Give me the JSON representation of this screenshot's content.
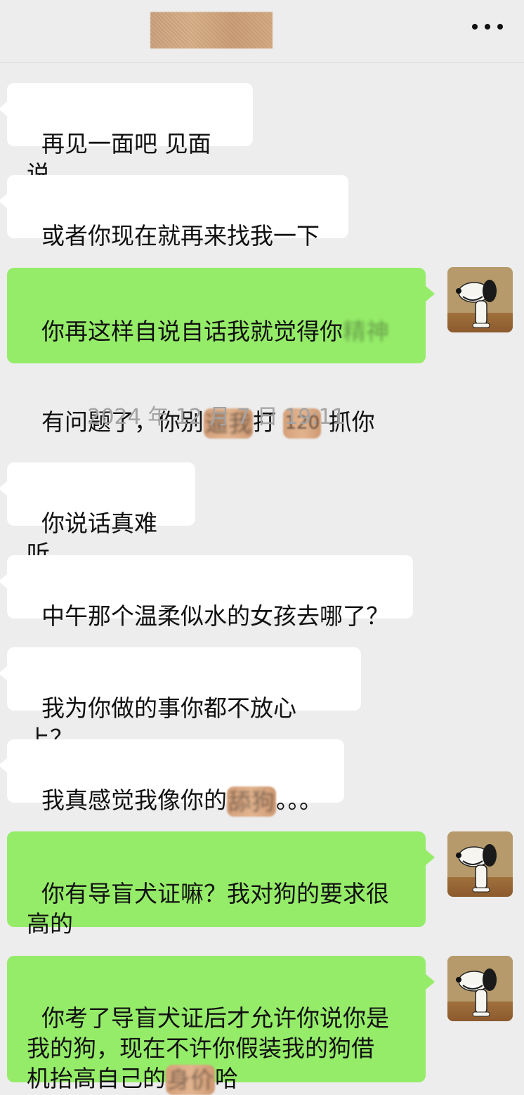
{
  "header": {
    "title_redacted": true,
    "more_icon": "more-dots-icon"
  },
  "avatar": {
    "icon": "snoopy-avatar"
  },
  "messages": [
    {
      "side": "in",
      "text": "再见一面吧 见面说"
    },
    {
      "side": "in",
      "text": "或者你现在就再来找我一下"
    },
    {
      "side": "out",
      "line1": "你再这样自说自话我就觉得你",
      "line1_tail": "精神",
      "line2a": "有问题了，你别",
      "line2_redact": "逼我",
      "line2b": "打",
      "line2_redact2": "120",
      "line2c": "抓你"
    },
    {
      "side": "in",
      "text": "你说话真难听"
    },
    {
      "side": "in",
      "text": "中午那个温柔似水的女孩去哪了？"
    },
    {
      "side": "in",
      "text": "我为你做的事你都不放心上？"
    },
    {
      "side": "in",
      "text_a": "我真感觉我像你的",
      "text_redact": "舔狗",
      "text_b": "。。。"
    },
    {
      "side": "out",
      "text": "你有导盲犬证嘛？我对狗的要求很\n高的"
    },
    {
      "side": "out",
      "text_a": "你考了导盲犬证后才允许你说你是\n我的狗，现在不许你假装我的狗借\n机抬高自己的",
      "text_redact": "身价",
      "text_b": "哈"
    }
  ],
  "timestamp": "2024 年 12 月 7 日 19:11"
}
